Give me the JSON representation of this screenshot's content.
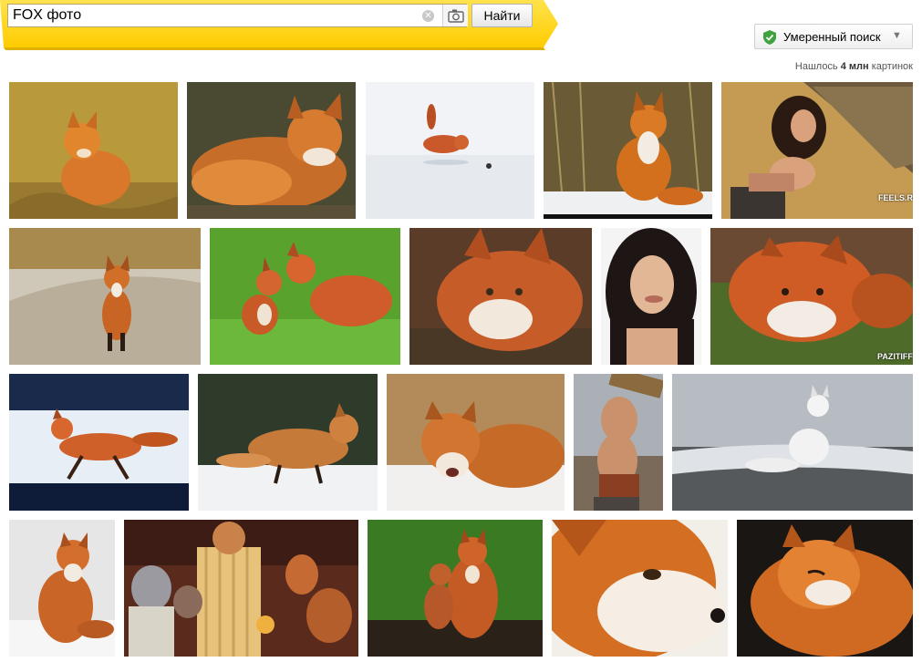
{
  "search": {
    "query": "FOX фото",
    "button_label": "Найти",
    "clear_icon": "clear-icon",
    "camera_icon": "camera-icon",
    "accent": "#ffcc00"
  },
  "safe_search": {
    "label": "Умеренный поиск",
    "shield_color": "#3ea33e",
    "arrow_icon": "chevron-down-icon"
  },
  "results": {
    "prefix": "Нашлось",
    "count": "4 млн",
    "suffix": "картинок"
  },
  "watermarks": {
    "feels": "FEELS.RU",
    "pazitif": "PAZITIFF"
  }
}
